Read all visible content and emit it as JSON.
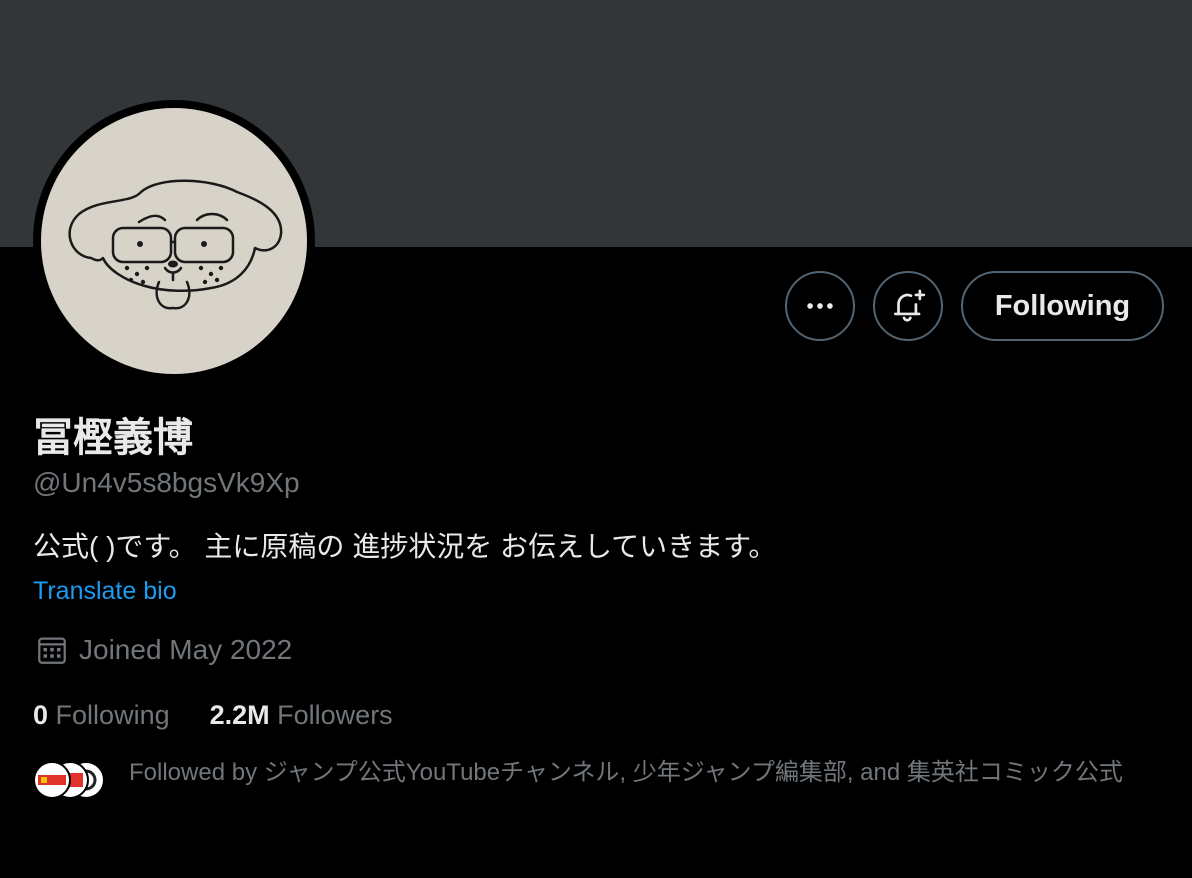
{
  "profile": {
    "name": "冨樫義博",
    "handle": "@Un4v5s8bgsVk9Xp",
    "bio": "公式( )です。 主に原稿の 進捗状況を お伝えしていきます。",
    "translate_bio": "Translate bio",
    "joined": "Joined May 2022",
    "following_count": "0",
    "following_label": "Following",
    "followers_count": "2.2M",
    "followers_label": "Followers",
    "followed_by": "Followed by ジャンプ公式YouTubeチャンネル, 少年ジャンプ編集部, and 集英社コミック公式"
  },
  "actions": {
    "more_icon": "more-horizontal-icon",
    "notify_icon": "bell-plus-icon",
    "follow_button": "Following"
  },
  "colors": {
    "banner": "#333639",
    "background": "#000000",
    "text_primary": "#e7e9ea",
    "text_secondary": "#71767b",
    "link": "#1d9bf0",
    "border": "#536471"
  }
}
